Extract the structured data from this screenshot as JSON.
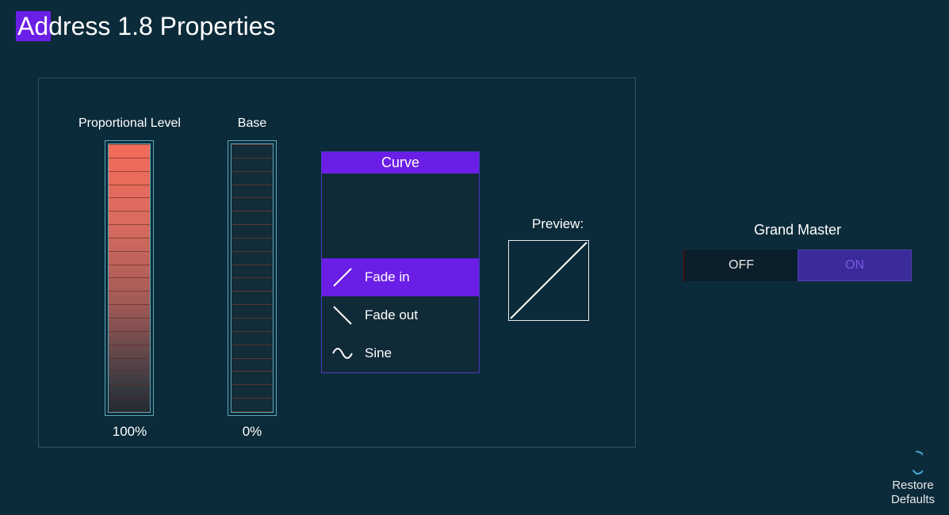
{
  "title": "Address 1.8 Properties",
  "sliders": {
    "proportional": {
      "label": "Proportional Level",
      "value": "100%"
    },
    "base": {
      "label": "Base",
      "value": "0%"
    }
  },
  "curve": {
    "header": "Curve",
    "items": [
      {
        "label": "Fade in",
        "selected": true
      },
      {
        "label": "Fade out",
        "selected": false
      },
      {
        "label": "Sine",
        "selected": false
      }
    ]
  },
  "preview": {
    "label": "Preview:"
  },
  "grandMaster": {
    "label": "Grand Master",
    "off": "OFF",
    "on": "ON",
    "state": "on"
  },
  "restore": {
    "line1": "Restore",
    "line2": "Defaults"
  }
}
